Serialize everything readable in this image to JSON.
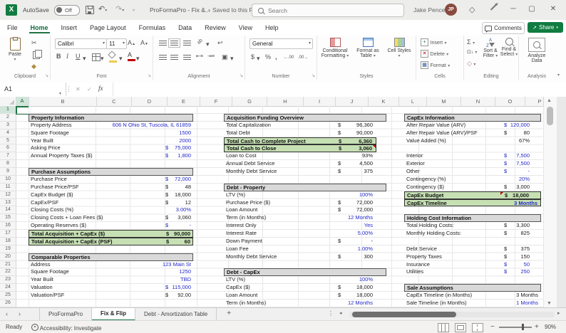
{
  "colors": {
    "accent_green": "#217346",
    "share_green": "#107C41",
    "highlight_green": "#C6E0B4",
    "input_blue": "#2428C8",
    "section_header_gray": "#D9D9D9"
  },
  "titlebar": {
    "autosave_label": "AutoSave",
    "autosave_state": "Off",
    "doc_title": "ProFormaPro - Fix &...",
    "saved_separator": "•",
    "saved_status": "Saved to this PC",
    "search_placeholder": "Search",
    "user_name": "Jake Pence",
    "user_initials": "JP"
  },
  "menubar": {
    "tabs": [
      "File",
      "Home",
      "Insert",
      "Page Layout",
      "Formulas",
      "Data",
      "Review",
      "View",
      "Help"
    ],
    "active_tab": "Home",
    "comments_label": "Comments",
    "share_label": "Share"
  },
  "ribbon": {
    "paste": "Paste",
    "clipboard_group": "Clipboard",
    "font_name": "Calibri",
    "font_size": "11",
    "bold": "B",
    "italic": "I",
    "underline": "U",
    "font_group": "Font",
    "alignment_group": "Alignment",
    "number_format": "General",
    "currency": "$",
    "percent": "%",
    "comma": ",",
    "inc_dec": "←.00",
    "dec_dec": ".00→",
    "number_group": "Number",
    "conditional_formatting": "Conditional Formatting",
    "format_as_table": "Format as Table",
    "cell_styles": "Cell Styles",
    "styles_group": "Styles",
    "insert": "Insert",
    "delete": "Delete",
    "format": "Format",
    "cells_group": "Cells",
    "autosum": "Σ",
    "sort_filter": "Sort & Filter",
    "find_select": "Find & Select",
    "editing_group": "Editing",
    "analyze_data": "Analyze Data",
    "analysis_group": "Analysis"
  },
  "formula_bar": {
    "name_box": "A1",
    "fx": "fx"
  },
  "sheet": {
    "col_headers": [
      "A",
      "B",
      "C",
      "D",
      "E",
      "F",
      "G",
      "H",
      "I",
      "J",
      "K",
      "L",
      "M",
      "N",
      "O",
      "P"
    ],
    "row_count": 26,
    "blocks": [
      {
        "col": "left",
        "title": "Property Information",
        "title_row": 2,
        "rows": [
          {
            "r": 3,
            "label": "Property Address",
            "value": "606 N Ohio St, Tuscola, IL 61859",
            "style": "blue"
          },
          {
            "r": 4,
            "label": "Square Footage",
            "value": "1500",
            "style": "blue"
          },
          {
            "r": 5,
            "label": "Year Built",
            "value": "2000",
            "style": "blue"
          },
          {
            "r": 6,
            "label": "Asking Price",
            "usd": "$",
            "value": "75,000",
            "style": "blue"
          },
          {
            "r": 7,
            "label": "Annual Property Taxes ($)",
            "usd": "$",
            "value": "1,800",
            "style": "blue"
          }
        ]
      },
      {
        "col": "left",
        "title": "Purchase Assumptions",
        "title_row": 9,
        "rows": [
          {
            "r": 10,
            "label": "Purchase Price",
            "usd": "$",
            "value": "72,000",
            "style": "blue"
          },
          {
            "r": 11,
            "label": "Purchase Price/PSF",
            "usd": "$",
            "value": "48",
            "style": "black"
          },
          {
            "r": 12,
            "label": "CapEx Budget ($)",
            "usd": "$",
            "value": "18,000",
            "style": "black"
          },
          {
            "r": 13,
            "label": "CapEx/PSF",
            "usd": "$",
            "value": "12",
            "style": "black"
          },
          {
            "r": 14,
            "label": "Closing Costs (%)",
            "value": "3.00%",
            "style": "blue"
          },
          {
            "r": 15,
            "label": "Closing Costs + Loan Fees ($)",
            "usd": "$",
            "value": "3,060",
            "style": "black"
          },
          {
            "r": 16,
            "label": "Operating Reserves ($)",
            "usd": "$",
            "value": "-",
            "style": "blue"
          },
          {
            "r": 17,
            "label": "Total Acquisition + CapEx ($)",
            "usd": "$",
            "value": "90,000",
            "style": "total"
          },
          {
            "r": 18,
            "label": "Total Acquisition + CapEx (PSF)",
            "usd": "$",
            "value": "60",
            "style": "total"
          }
        ]
      },
      {
        "col": "left",
        "title": "Comparable Properties",
        "title_row": 20,
        "rows": [
          {
            "r": 21,
            "label": "Address",
            "value": "123 Main St",
            "style": "blue"
          },
          {
            "r": 22,
            "label": "Square Footage",
            "value": "1250",
            "style": "blue"
          },
          {
            "r": 23,
            "label": "Year Built",
            "value": "TBD",
            "style": "blue"
          },
          {
            "r": 24,
            "label": "Valuation",
            "usd": "$",
            "value": "115,000",
            "style": "blue"
          },
          {
            "r": 25,
            "label": "Valuation/PSF",
            "usd": "$",
            "value": "92.00",
            "style": "black"
          }
        ]
      },
      {
        "col": "middle",
        "title": "Acquisition Funding Overview",
        "title_row": 2,
        "rows": [
          {
            "r": 3,
            "label": "Total Capitalization",
            "usd": "$",
            "value": "96,360",
            "style": "black"
          },
          {
            "r": 4,
            "label": "Total Debt",
            "usd": "$",
            "value": "90,000",
            "style": "black"
          },
          {
            "r": 5,
            "label": "Total Cash to Complete Project",
            "usd": "$",
            "value": "6,360",
            "style": "total"
          },
          {
            "r": 6,
            "label": "Total Cash to Close",
            "usd": "$",
            "value": "3,060",
            "style": "total",
            "note": "right"
          },
          {
            "r": 7,
            "label": "Loan to Cost",
            "value": "93%",
            "style": "black"
          },
          {
            "r": 8,
            "label": "Annual Debt Service",
            "usd": "$",
            "value": "4,500",
            "style": "black"
          },
          {
            "r": 9,
            "label": "Monthly Debt Service",
            "usd": "$",
            "value": "375",
            "style": "black"
          }
        ]
      },
      {
        "col": "middle",
        "title": "Debt - Property",
        "title_row": 11,
        "rows": [
          {
            "r": 12,
            "label": "LTV (%)",
            "value": "100%",
            "style": "blue"
          },
          {
            "r": 13,
            "label": "Purchase Price ($)",
            "usd": "$",
            "value": "72,000",
            "style": "black"
          },
          {
            "r": 14,
            "label": "Loan Amount",
            "usd": "$",
            "value": "72,000",
            "style": "black"
          },
          {
            "r": 15,
            "label": "Term (in Months)",
            "value": "12 Months",
            "style": "blue"
          },
          {
            "r": 16,
            "label": "Interest Only",
            "value": "Yes",
            "style": "blue"
          },
          {
            "r": 17,
            "label": "Interest Rate",
            "value": "5.00%",
            "style": "blue"
          },
          {
            "r": 18,
            "label": "Down Payment",
            "usd": "$",
            "value": "-",
            "style": "black"
          },
          {
            "r": 19,
            "label": "Loan Fee",
            "value": "1.00%",
            "style": "blue"
          },
          {
            "r": 20,
            "label": "Monthly Debt Service",
            "usd": "$",
            "value": "300",
            "style": "black"
          }
        ]
      },
      {
        "col": "middle",
        "title": "Debt - CapEx",
        "title_row": 22,
        "rows": [
          {
            "r": 23,
            "label": "LTV (%)",
            "value": "100%",
            "style": "blue"
          },
          {
            "r": 24,
            "label": "CapEx ($)",
            "usd": "$",
            "value": "18,000",
            "style": "black"
          },
          {
            "r": 25,
            "label": "Loan Amount",
            "usd": "$",
            "value": "18,000",
            "style": "black"
          },
          {
            "r": 26,
            "label": "Term (in Months)",
            "value": "12 Months",
            "style": "blue"
          }
        ]
      },
      {
        "col": "right",
        "title": "CapEx Information",
        "title_row": 2,
        "rows": [
          {
            "r": 3,
            "label": "After Repair Value (ARV)",
            "usd": "$",
            "value": "120,000",
            "style": "blue"
          },
          {
            "r": 4,
            "label": "After Repair Value (ARV)/PSF",
            "usd": "$",
            "value": "80",
            "style": "black"
          },
          {
            "r": 5,
            "label": "Value Added (%)",
            "value": "67%",
            "style": "black"
          },
          {
            "r": 7,
            "label": "Interior",
            "usd": "$",
            "value": "7,500",
            "style": "blue"
          },
          {
            "r": 8,
            "label": "Exterior",
            "usd": "$",
            "value": "7,500",
            "style": "blue"
          },
          {
            "r": 9,
            "label": "Other",
            "usd": "$",
            "value": "-",
            "style": "blue"
          },
          {
            "r": 10,
            "label": "Contingency (%)",
            "value": "20%",
            "style": "blue"
          },
          {
            "r": 11,
            "label": "Contingency ($)",
            "usd": "$",
            "value": "3,000",
            "style": "black"
          },
          {
            "r": 12,
            "label": "CapEx Budget",
            "usd": "$",
            "value": "18,000",
            "style": "total",
            "note": "left"
          },
          {
            "r": 13,
            "label": "CapEx Timeline",
            "value": "3 Months",
            "style": "total-blue"
          }
        ]
      },
      {
        "col": "right",
        "title": "Holding Cost Information",
        "title_row": 15,
        "rows": [
          {
            "r": 16,
            "label": "Total Holding Costs:",
            "usd": "$",
            "value": "3,300",
            "style": "black"
          },
          {
            "r": 17,
            "label": "Monthly Holding Costs:",
            "usd": "$",
            "value": "825",
            "style": "black"
          },
          {
            "r": 19,
            "label": "Debt Service",
            "usd": "$",
            "value": "375",
            "style": "black"
          },
          {
            "r": 20,
            "label": "Property Taxes",
            "usd": "$",
            "value": "150",
            "style": "black"
          },
          {
            "r": 21,
            "label": "Insurance",
            "usd": "$",
            "value": "50",
            "style": "blue"
          },
          {
            "r": 22,
            "label": "Utilities",
            "usd": "$",
            "value": "250",
            "style": "blue"
          }
        ]
      },
      {
        "col": "right",
        "title": "Sale Assumptions",
        "title_row": 24,
        "rows": [
          {
            "r": 25,
            "label": "CapEx Timeline (in Months)",
            "value": "3 Months",
            "style": "black"
          },
          {
            "r": 26,
            "label": "Sale Timeline (in Months)",
            "value": "1 Months",
            "style": "blue"
          }
        ]
      }
    ]
  },
  "sheet_tabs": {
    "tabs": [
      "ProFormaPro",
      "Fix & Flip",
      "Debt - Amortization Table"
    ],
    "active": "Fix & Flip",
    "add": "+"
  },
  "status_bar": {
    "mode": "Ready",
    "accessibility": "Accessibility: Investigate",
    "zoom": "90%"
  }
}
